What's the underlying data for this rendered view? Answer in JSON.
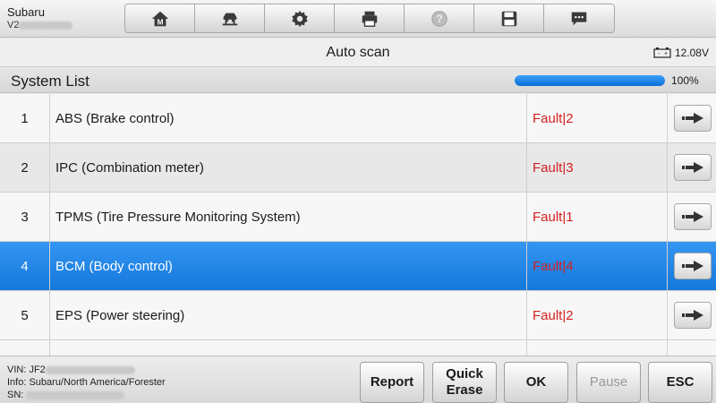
{
  "header": {
    "brand": "Subaru",
    "version_prefix": "V2",
    "toolbar": [
      {
        "icon": "home-icon"
      },
      {
        "icon": "vehicle-lift-icon"
      },
      {
        "icon": "gear-icon"
      },
      {
        "icon": "printer-icon"
      },
      {
        "icon": "help-icon"
      },
      {
        "icon": "save-icon"
      },
      {
        "icon": "message-icon"
      }
    ]
  },
  "titlebar": {
    "title": "Auto scan",
    "battery_voltage": "12.08V"
  },
  "system_list": {
    "label": "System List",
    "progress_percent": 100,
    "progress_label": "100%",
    "rows": [
      {
        "num": "1",
        "name": "ABS (Brake control)",
        "status": "Fault|2"
      },
      {
        "num": "2",
        "name": "IPC (Combination meter)",
        "status": "Fault|3"
      },
      {
        "num": "3",
        "name": "TPMS (Tire Pressure Monitoring System)",
        "status": "Fault|1"
      },
      {
        "num": "4",
        "name": "BCM (Body control)",
        "status": "Fault|4"
      },
      {
        "num": "5",
        "name": "EPS (Power steering)",
        "status": "Fault|2"
      }
    ],
    "selected_index": 3
  },
  "footer": {
    "vin_label": "VIN: JF2",
    "info_label": "Info: Subaru/North America/Forester",
    "sn_label": "SN:",
    "buttons": {
      "report": "Report",
      "quick_erase_line1": "Quick",
      "quick_erase_line2": "Erase",
      "ok": "OK",
      "pause": "Pause",
      "esc": "ESC"
    }
  },
  "colors": {
    "selected_row": "#1a82e6",
    "fault_text": "#d61f1f",
    "progress_fill": "#1a82e6"
  }
}
